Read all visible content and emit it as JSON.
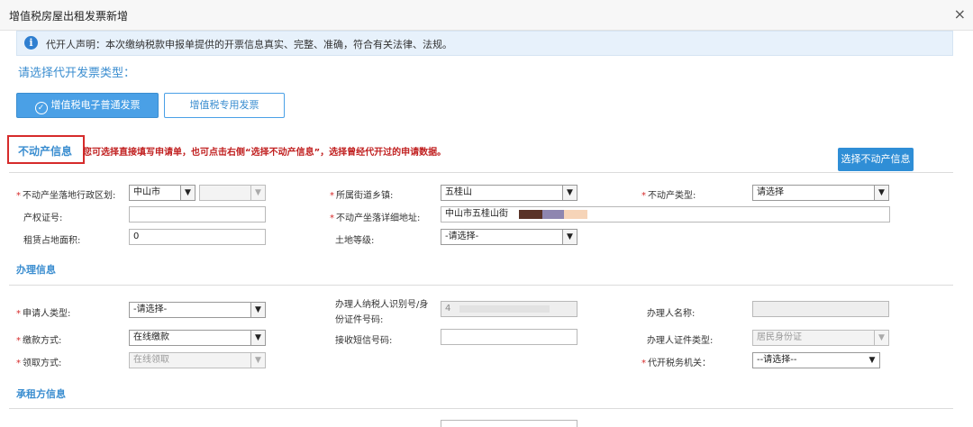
{
  "window": {
    "title": "增值税房屋出租发票新增",
    "close_glyph": "×"
  },
  "notice": {
    "icon": "info-icon",
    "icon_glyph": "i",
    "text": "代开人声明：本次缴纳税款申报单提供的开票信息真实、完整、准确，符合有关法律、法规。"
  },
  "invoice_type": {
    "prompt": "请选择代开发票类型：",
    "options": [
      {
        "label": "增值税电子普通发票",
        "selected": true
      },
      {
        "label": "增值税专用发票",
        "selected": false
      }
    ]
  },
  "property": {
    "section_title": "不动产信息",
    "hint": "您可选择直接填写申请单，也可点击右侧“选择不动产信息”，选择曾经代开过的申请数据。",
    "select_button": "选择不动产信息",
    "district_label": "不动产坐落地行政区划:",
    "district_city": "中山市",
    "district_sub": "",
    "street_label": "所属街道乡镇:",
    "street_value": "五桂山",
    "type_label": "不动产类型:",
    "type_value": "请选择",
    "cert_label": "产权证号:",
    "cert_value": "",
    "address_label": "不动产坐落详细地址:",
    "address_value": "中山市五桂山街",
    "area_label": "租赁占地面积:",
    "area_value": "0",
    "land_grade_label": "土地等级:",
    "land_grade_value": "-请选择-"
  },
  "handling": {
    "section_title": "办理信息",
    "applicant_type_label": "申请人类型:",
    "applicant_type_value": "-请选择-",
    "handler_id_label_1": "办理人纳税人识别号/身",
    "handler_id_label_2": "份证件号码:",
    "handler_id_value": "4",
    "handler_name_label": "办理人名称:",
    "handler_name_value": "",
    "payment_label": "缴款方式:",
    "payment_value": "在线缴款",
    "sms_label": "接收短信号码:",
    "sms_value": "",
    "cert_type_label": "办理人证件类型:",
    "cert_type_value": "居民身份证",
    "collect_label": "领取方式:",
    "collect_value": "在线领取",
    "tax_office_label": "代开税务机关：",
    "tax_office_value": "--请选择--"
  },
  "lessee": {
    "section_title": "承租方信息"
  },
  "icons": {
    "dropdown": "chevron-down-icon",
    "dropdown_glyph": "▼",
    "check_glyph": "✓",
    "required_mark": "*"
  },
  "colors": {
    "accent": "#3b8ed0",
    "primary_button": "#4aa0e6",
    "required": "#d62b2b",
    "highlight_box": "#d62b2b",
    "notice_bg": "#e7f1fb"
  }
}
